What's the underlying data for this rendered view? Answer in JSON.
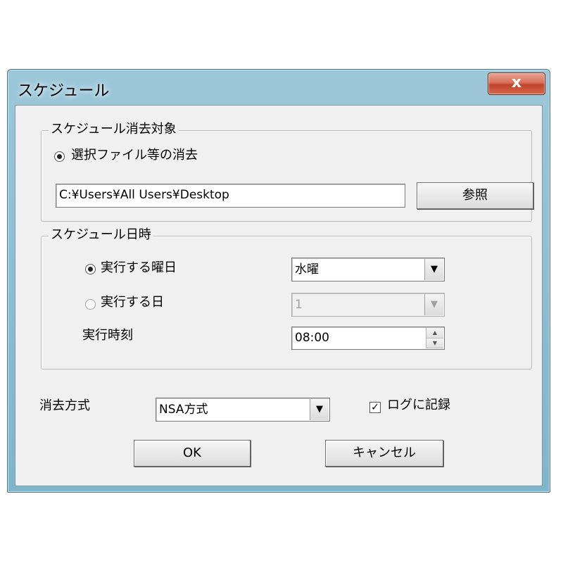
{
  "window": {
    "title": "スケジュール",
    "close_label": "x"
  },
  "target_group": {
    "legend": "スケジュール消去対象",
    "radio_label": "選択ファイル等の消去",
    "path_value": "C:¥Users¥All Users¥Desktop",
    "browse_label": "参照"
  },
  "datetime_group": {
    "legend": "スケジュール日時",
    "weekday_radio_label": "実行する曜日",
    "weekday_value": "水曜",
    "day_radio_label": "実行する日",
    "day_value": "1",
    "time_label": "実行時刻",
    "time_value": "08:00"
  },
  "method": {
    "label": "消去方式",
    "value": "NSA方式"
  },
  "log": {
    "label": "ログに記録",
    "checked": true,
    "check_glyph": "✓"
  },
  "buttons": {
    "ok_label": "OK",
    "cancel_label": "キャンセル"
  },
  "icons": {
    "dropdown_glyph": "▼"
  }
}
